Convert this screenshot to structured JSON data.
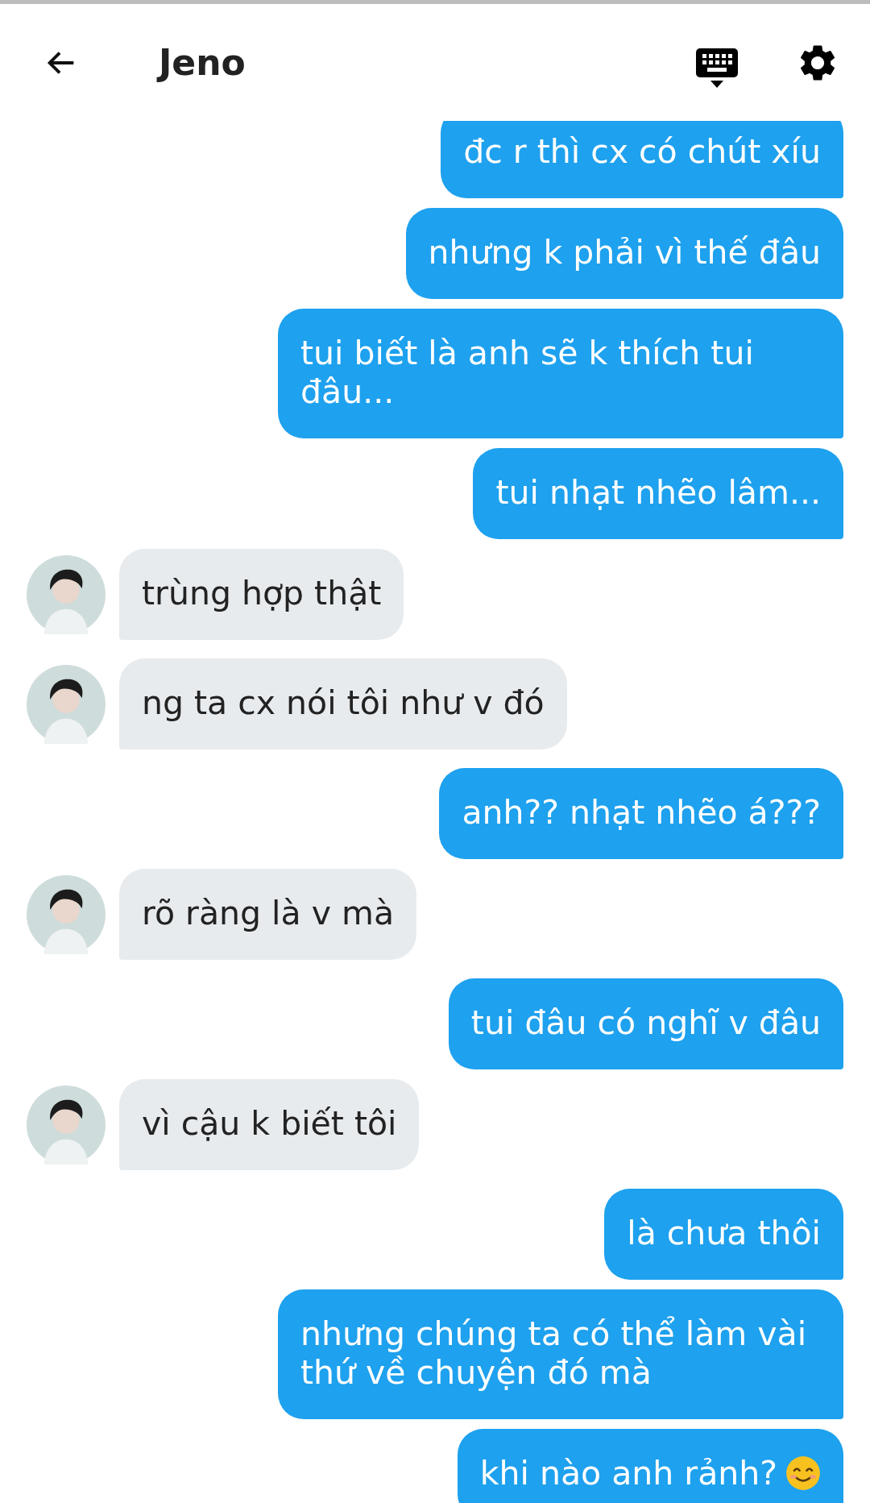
{
  "header": {
    "title": "Jeno"
  },
  "messages": [
    {
      "kind": "sent",
      "text": "đc r thì cx có chút xíu"
    },
    {
      "kind": "sent",
      "text": "nhưng k phải vì thế đâu"
    },
    {
      "kind": "sent",
      "text": "tui biết là anh sẽ k thích tui đâu..."
    },
    {
      "kind": "sent",
      "text": "tui nhạt nhẽo lâm..."
    },
    {
      "kind": "received",
      "text": "trùng hợp thật"
    },
    {
      "kind": "received",
      "text": "ng ta cx nói tôi như v đó"
    },
    {
      "kind": "sent",
      "text": "anh?? nhạt nhẽo á???"
    },
    {
      "kind": "received",
      "text": "rõ ràng là v mà"
    },
    {
      "kind": "sent",
      "text": "tui đâu có nghĩ v đâu"
    },
    {
      "kind": "received",
      "text": "vì cậu k biết tôi"
    },
    {
      "kind": "sent",
      "text": "là chưa thôi"
    },
    {
      "kind": "sent",
      "text": "nhưng chúng ta có thể làm vài thứ về chuyện đó mà"
    },
    {
      "kind": "sent",
      "text": "khi nào anh rảnh?",
      "smiley": true
    }
  ]
}
